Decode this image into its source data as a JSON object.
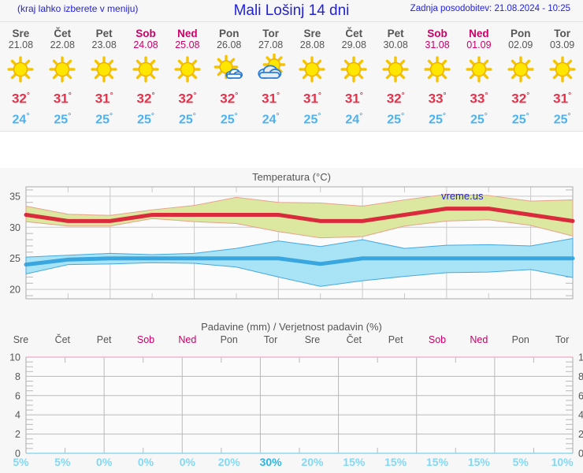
{
  "header": {
    "note": "(kraj lahko izberete v meniju)",
    "title": "Mali Lošinj 14 dni",
    "updated": "Zadnja posodobitev: 21.08.2024 - 10:25",
    "note_color": "#2222dd"
  },
  "colors": {
    "temp_max": "#e8304a",
    "temp_min": "#4db2ef",
    "weekend": "#cc0066",
    "weekday": "#555555",
    "band_max": "#d7e48f",
    "band_min": "#9fe0f5",
    "watermark": "#2222dd"
  },
  "watermark": "vreme.us",
  "days": [
    {
      "name": "Sre",
      "date": "21.08",
      "weekend": false,
      "icon": "sun-icon",
      "tmax": "32",
      "tmin": "24"
    },
    {
      "name": "Čet",
      "date": "22.08",
      "weekend": false,
      "icon": "sun-icon",
      "tmax": "31",
      "tmin": "25"
    },
    {
      "name": "Pet",
      "date": "23.08",
      "weekend": false,
      "icon": "sun-icon",
      "tmax": "31",
      "tmin": "25"
    },
    {
      "name": "Sob",
      "date": "24.08",
      "weekend": true,
      "icon": "sun-icon",
      "tmax": "32",
      "tmin": "25"
    },
    {
      "name": "Ned",
      "date": "25.08",
      "weekend": true,
      "icon": "sun-icon",
      "tmax": "32",
      "tmin": "25"
    },
    {
      "name": "Pon",
      "date": "26.08",
      "weekend": false,
      "icon": "sun-small-cloud-icon",
      "tmax": "32",
      "tmin": "25"
    },
    {
      "name": "Tor",
      "date": "27.08",
      "weekend": false,
      "icon": "sun-behind-cloud-icon",
      "tmax": "31",
      "tmin": "24"
    },
    {
      "name": "Sre",
      "date": "28.08",
      "weekend": false,
      "icon": "sun-icon",
      "tmax": "31",
      "tmin": "25"
    },
    {
      "name": "Čet",
      "date": "29.08",
      "weekend": false,
      "icon": "sun-icon",
      "tmax": "31",
      "tmin": "24"
    },
    {
      "name": "Pet",
      "date": "30.08",
      "weekend": false,
      "icon": "sun-icon",
      "tmax": "32",
      "tmin": "25"
    },
    {
      "name": "Sob",
      "date": "31.08",
      "weekend": true,
      "icon": "sun-icon",
      "tmax": "33",
      "tmin": "25"
    },
    {
      "name": "Ned",
      "date": "01.09",
      "weekend": true,
      "icon": "sun-icon",
      "tmax": "33",
      "tmin": "25"
    },
    {
      "name": "Pon",
      "date": "02.09",
      "weekend": false,
      "icon": "sun-icon",
      "tmax": "32",
      "tmin": "25"
    },
    {
      "name": "Tor",
      "date": "03.09",
      "weekend": false,
      "icon": "sun-icon",
      "tmax": "31",
      "tmin": "25"
    }
  ],
  "degree_symbol": "°",
  "precip_day_labels": [
    {
      "name": "Sre",
      "weekend": false
    },
    {
      "name": "Čet",
      "weekend": false
    },
    {
      "name": "Pet",
      "weekend": false
    },
    {
      "name": "Sob",
      "weekend": true
    },
    {
      "name": "Ned",
      "weekend": true
    },
    {
      "name": "Pon",
      "weekend": false
    },
    {
      "name": "Tor",
      "weekend": false
    },
    {
      "name": "Sre",
      "weekend": false
    },
    {
      "name": "Čet",
      "weekend": false
    },
    {
      "name": "Pet",
      "weekend": false
    },
    {
      "name": "Sob",
      "weekend": true
    },
    {
      "name": "Ned",
      "weekend": true
    },
    {
      "name": "Pon",
      "weekend": false
    },
    {
      "name": "Tor",
      "weekend": false
    }
  ],
  "precip_percent_labels": [
    "5%",
    "5%",
    "0%",
    "0%",
    "0%",
    "20%",
    "30%",
    "20%",
    "15%",
    "15%",
    "15%",
    "15%",
    "5%",
    "10%"
  ],
  "chart_data": [
    {
      "type": "area",
      "title": "Temperatura (°C)",
      "xlabel": "",
      "ylabel": "",
      "ylim": [
        18.5,
        36.5
      ],
      "yticks": [
        20,
        25,
        30,
        35
      ],
      "grid": true,
      "legend": "none",
      "x": [
        1,
        2,
        3,
        4,
        5,
        6,
        7,
        8,
        9,
        10,
        11,
        12,
        13,
        14
      ],
      "series": [
        {
          "name": "Najvišja temperatura",
          "color": "#e8304a",
          "values": [
            32,
            31,
            31,
            32,
            32,
            32,
            32,
            31,
            31,
            32,
            33,
            33,
            32,
            31
          ]
        },
        {
          "name": "Najvišja temperatura - zgornja meja",
          "color": "#d7e48f",
          "values": [
            33.4,
            32.1,
            31.9,
            32.8,
            33.5,
            34.8,
            34.0,
            33.9,
            33.4,
            34.4,
            35.3,
            35.1,
            34.2,
            34.4
          ]
        },
        {
          "name": "Najvišja temperatura - spodnja meja",
          "color": "#d7e48f",
          "values": [
            30.9,
            30.2,
            30.2,
            31.4,
            30.9,
            30.6,
            29.3,
            28.3,
            28.5,
            30.2,
            31.0,
            31.2,
            30.3,
            28.6
          ]
        },
        {
          "name": "Najnižja temperatura",
          "color": "#4db2ef",
          "values": [
            24.0,
            24.8,
            25.0,
            25.0,
            25.0,
            25.0,
            25.0,
            24.1,
            25.0,
            25.0,
            25.0,
            25.0,
            25.0,
            25.0
          ]
        },
        {
          "name": "Najnižja temperatura - zgornja meja",
          "color": "#9fe0f5",
          "values": [
            25.2,
            25.5,
            25.8,
            25.6,
            25.8,
            26.6,
            27.8,
            26.9,
            28.0,
            26.6,
            27.1,
            27.2,
            27.0,
            28.2
          ]
        },
        {
          "name": "Najnižja temperatura - spodnja meja",
          "color": "#9fe0f5",
          "values": [
            22.5,
            24.0,
            24.1,
            24.3,
            24.2,
            23.6,
            22.0,
            20.5,
            21.4,
            22.1,
            22.7,
            22.8,
            23.2,
            21.9
          ]
        }
      ]
    },
    {
      "type": "bar",
      "title": "Padavine (mm) / Verjetnost padavin (%)",
      "xlabel": "",
      "ylabel": "",
      "ylim": [
        0,
        10
      ],
      "yticks": [
        0,
        2,
        4,
        6,
        8,
        10
      ],
      "grid": true,
      "categories": [
        "Sre",
        "Čet",
        "Pet",
        "Sob",
        "Ned",
        "Pon",
        "Tor",
        "Sre",
        "Čet",
        "Pet",
        "Sob",
        "Ned",
        "Pon",
        "Tor"
      ],
      "values": [
        0,
        0,
        0,
        0,
        0,
        0,
        0,
        0,
        0,
        0,
        0,
        0,
        0,
        0
      ],
      "probability_percent": [
        5,
        5,
        0,
        0,
        0,
        20,
        30,
        20,
        15,
        15,
        15,
        15,
        5,
        10
      ]
    }
  ]
}
